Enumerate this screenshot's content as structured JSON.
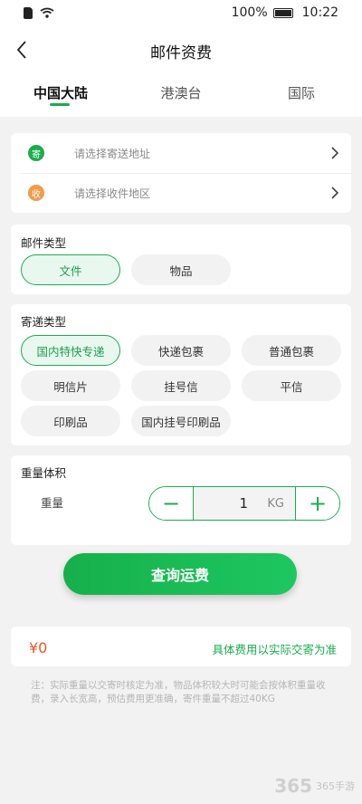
{
  "status_bar": {
    "battery": "100%",
    "time": "10:22"
  },
  "nav": {
    "title": "邮件资费"
  },
  "tabs": [
    {
      "label": "中国大陆"
    },
    {
      "label": "港澳台"
    },
    {
      "label": "国际"
    }
  ],
  "address": {
    "sender_icon": "寄",
    "sender_placeholder": "请选择寄送地址",
    "receiver_icon": "收",
    "receiver_placeholder": "请选择收件地区"
  },
  "mail_type": {
    "title": "邮件类型",
    "options": [
      "文件",
      "物品"
    ],
    "selected": "文件"
  },
  "delivery_type": {
    "title": "寄递类型",
    "options": [
      "国内特快专递",
      "快递包裹",
      "普通包裹",
      "明信片",
      "挂号信",
      "平信",
      "印刷品",
      "国内挂号印刷品"
    ],
    "selected": "国内特快专递"
  },
  "weight": {
    "title": "重量体积",
    "label": "重量",
    "minus": "−",
    "plus": "+",
    "value": "1",
    "unit": "KG"
  },
  "query_button": "查询运费",
  "result": {
    "price": "¥0",
    "note": "具体费用以实际交寄为准"
  },
  "footnote": "注：实际重量以交寄时核定为准，物品体积较大时可能会按体积重量收费，录入长宽高，预估费用更准确，寄件重量不超过40KG",
  "watermark": {
    "brand": "365手游",
    "number": "365"
  },
  "colors": {
    "accent": "#1aad4e",
    "sender_icon": "#1aad4e",
    "receiver_icon": "#f29b4a",
    "price": "#e9542a"
  }
}
